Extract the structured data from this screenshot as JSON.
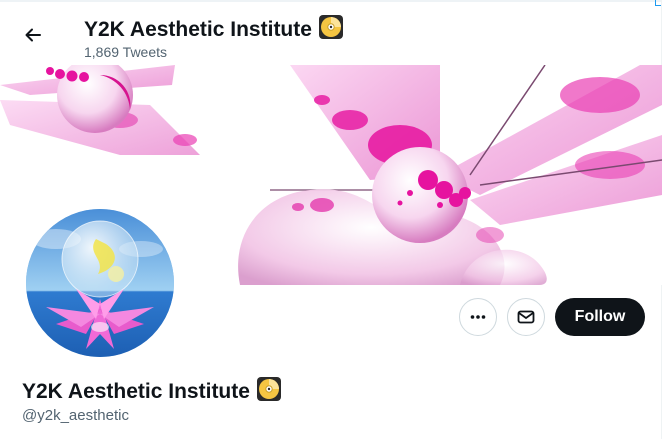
{
  "header": {
    "display_name": "Y2K Aesthetic Institute",
    "tweet_count": "1,869 Tweets"
  },
  "profile": {
    "display_name": "Y2K Aesthetic Institute",
    "handle": "@y2k_aesthetic",
    "follow_label": "Follow",
    "badge_icon": "cd-disc-emoji-icon"
  },
  "colors": {
    "follow_bg": "#0f1419",
    "secondary_text": "#536471",
    "banner_accent": "#e6139f",
    "banner_pink": "#f5b8e6"
  }
}
